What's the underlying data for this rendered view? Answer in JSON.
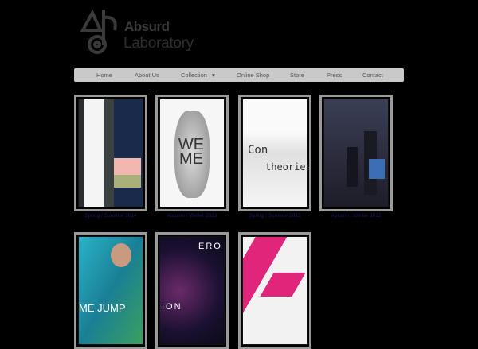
{
  "logo": {
    "line1": "Absurd",
    "line2": "Laboratory"
  },
  "nav": {
    "items": [
      {
        "label": "Home"
      },
      {
        "label": "About Us"
      },
      {
        "label": "Collection",
        "icon": "caret-down-icon",
        "caret": "▾"
      },
      {
        "label": "Online Shop"
      },
      {
        "label": "Store"
      },
      {
        "label": "Press"
      },
      {
        "label": "Contact"
      }
    ]
  },
  "gallery": {
    "items": [
      {
        "caption": "Spring / Summer 2014"
      },
      {
        "caption": "Autumn / Winter 2013"
      },
      {
        "caption": "Spring / Summer 2013"
      },
      {
        "caption": "Autumn / Winter 2012"
      },
      {
        "caption": ""
      },
      {
        "caption": ""
      },
      {
        "caption": ""
      }
    ]
  },
  "thumb_text": {
    "weme": "WE ME",
    "con": "Con",
    "theories": "theories",
    "jump": "ME JUMP",
    "ero": "ERO",
    "ion": "ION"
  },
  "colors": {
    "nav_bg": "#c9c9c9",
    "caption": "#1a1a66",
    "frame": "#9a9a9a"
  }
}
